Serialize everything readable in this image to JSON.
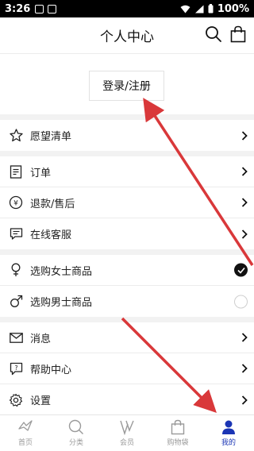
{
  "status_bar": {
    "time": "3:26",
    "battery": "100%"
  },
  "header": {
    "title": "个人中心",
    "search_icon": "search-icon",
    "bag_icon": "shopping-bag-icon"
  },
  "login": {
    "label": "登录/注册"
  },
  "groups": {
    "wishlist": {
      "label": "愿望清单"
    },
    "orders": [
      {
        "label": "订单"
      },
      {
        "label": "退款/售后"
      },
      {
        "label": "在线客服"
      }
    ],
    "shop_gender": [
      {
        "label": "选购女士商品",
        "selected": true
      },
      {
        "label": "选购男士商品",
        "selected": false
      }
    ],
    "settings": [
      {
        "label": "消息"
      },
      {
        "label": "帮助中心"
      },
      {
        "label": "设置"
      }
    ]
  },
  "bottom_nav": [
    {
      "label": "首页",
      "icon": "home-icon",
      "active": false
    },
    {
      "label": "分类",
      "icon": "category-search-icon",
      "active": false
    },
    {
      "label": "会员",
      "icon": "member-icon",
      "active": false
    },
    {
      "label": "购物袋",
      "icon": "shopping-bag-icon",
      "active": false
    },
    {
      "label": "我的",
      "icon": "profile-icon",
      "active": true
    }
  ],
  "colors": {
    "accent": "#1b35b5",
    "arrow": "#d9383a"
  }
}
